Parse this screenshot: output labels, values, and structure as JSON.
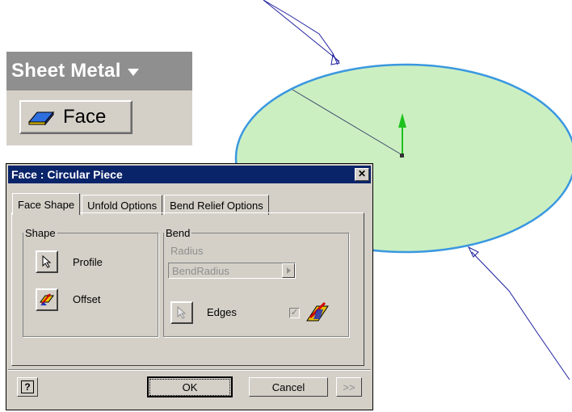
{
  "toolbar_panel": {
    "title": "Sheet Metal",
    "tool_label": "Face"
  },
  "dialog": {
    "title": "Face : Circular Piece",
    "tabs": [
      {
        "label": "Face Shape"
      },
      {
        "label": "Unfold Options"
      },
      {
        "label": "Bend Relief Options"
      }
    ],
    "shape_group": {
      "legend": "Shape",
      "profile_label": "Profile",
      "offset_label": "Offset"
    },
    "bend_group": {
      "legend": "Bend",
      "radius_label": "Radius",
      "radius_value": "BendRadius",
      "edges_label": "Edges"
    },
    "buttons": {
      "help": "?",
      "ok": "OK",
      "cancel": "Cancel",
      "more": ">>"
    }
  },
  "colors": {
    "face_fill": "#ccefc2",
    "face_edge": "#3a98e0",
    "axis_arrow": "#1ec21e",
    "title_bar": "#0a246a"
  }
}
